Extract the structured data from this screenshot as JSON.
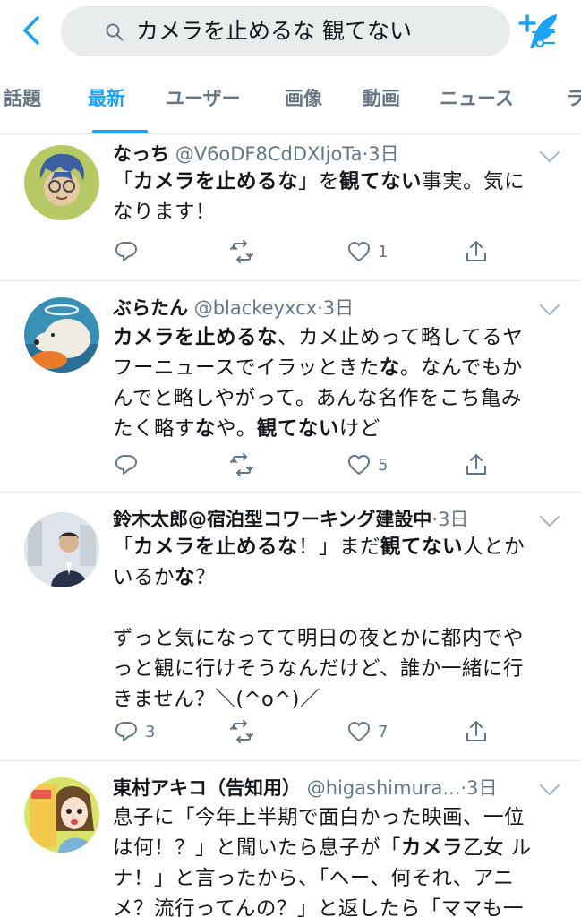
{
  "search": {
    "query": "カメラを止めるな 観てない"
  },
  "tabs": [
    "話題",
    "最新",
    "ユーザー",
    "画像",
    "動画",
    "ニュース",
    "ラ"
  ],
  "colors": {
    "accent": "#1da1f2",
    "muted": "#657786",
    "text": "#14171a"
  },
  "tweets": [
    {
      "name": "なっち",
      "handle": "@V6oDF8CdDXIjoTa",
      "dot": "·",
      "time": "3日",
      "avatar_icon": "cartoon-avatar-icon",
      "body": [
        [
          {
            "t": "「"
          },
          {
            "t": "カメラを止めるな",
            "b": true
          },
          {
            "t": "」を"
          },
          {
            "t": "観てない",
            "b": true
          },
          {
            "t": "事実。気に"
          }
        ],
        [
          {
            "t": "なります！"
          }
        ]
      ],
      "replies": "",
      "retweets": "",
      "likes": "1"
    },
    {
      "name": "ぶらたん",
      "handle": "@blackeyxcx",
      "dot": "·",
      "time": "3日",
      "avatar_icon": "polar-bear-avatar-icon",
      "body": [
        [
          {
            "t": "カメラを止めるな",
            "b": true
          },
          {
            "t": "、カメ止めって略してるヤ"
          }
        ],
        [
          {
            "t": "フーニュースでイラッときた"
          },
          {
            "t": "な",
            "b": true
          },
          {
            "t": "。なんでもか"
          }
        ],
        [
          {
            "t": "んでと略しやがって。あんな名作をこち亀み"
          }
        ],
        [
          {
            "t": "たく略す"
          },
          {
            "t": "な",
            "b": true
          },
          {
            "t": "や。"
          },
          {
            "t": "観てない",
            "b": true
          },
          {
            "t": "けど"
          }
        ]
      ],
      "replies": "",
      "retweets": "",
      "likes": "5"
    },
    {
      "name": "鈴木太郎@宿泊型コワーキング建設中",
      "handle": "",
      "dot": "·",
      "time": "3日",
      "avatar_icon": "person-photo-avatar-icon",
      "body": [
        [
          {
            "t": "「"
          },
          {
            "t": "カメラを止めるな",
            "b": true
          },
          {
            "t": "！」まだ"
          },
          {
            "t": "観てない",
            "b": true
          },
          {
            "t": "人とか"
          }
        ],
        [
          {
            "t": "いるか"
          },
          {
            "t": "な",
            "b": true
          },
          {
            "t": "？"
          }
        ],
        [
          {
            "t": ""
          }
        ],
        [
          {
            "t": "ずっと気になってて明日の夜とかに都内でや"
          }
        ],
        [
          {
            "t": "っと観に行けそうなんだけど、誰か一緒に行"
          }
        ],
        [
          {
            "t": "きません？＼(^o^)／"
          }
        ]
      ],
      "replies": "3",
      "retweets": "",
      "likes": "7"
    },
    {
      "name": "東村アキコ（告知用）",
      "handle": "@higashimura...",
      "dot": "·",
      "time": "3日",
      "avatar_icon": "manga-avatar-icon",
      "body": [
        [
          {
            "t": "息子に「今年上半期で面白かった映画、一位"
          }
        ],
        [
          {
            "t": "は何！？」と聞いたら息子が「"
          },
          {
            "t": "カメラ",
            "b": true
          },
          {
            "t": "乙女 ル"
          }
        ],
        [
          {
            "t": "ナ！」と言ったから、「へー、何それ、アニ"
          }
        ],
        [
          {
            "t": "メ？流行ってんの？」と返したら「ママも一"
          }
        ]
      ],
      "replies": "",
      "retweets": "",
      "likes": ""
    }
  ]
}
